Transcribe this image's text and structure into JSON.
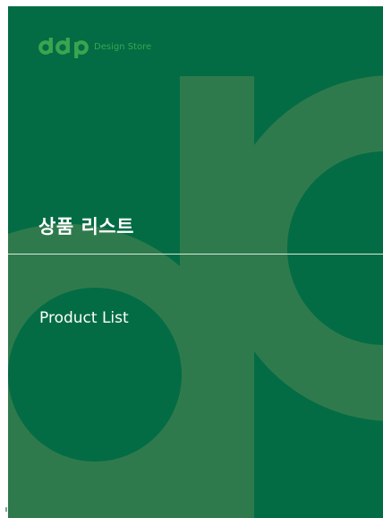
{
  "brand": {
    "logo_icon": "ddp-logo-icon",
    "logo_text": "Design Store",
    "logo_color": "#3aa54f"
  },
  "cover": {
    "title_korean": "상품 리스트",
    "title_english": "Product List",
    "background_color": "#036c44",
    "shape_color": "#2f7a4c",
    "text_color": "#ffffff"
  }
}
